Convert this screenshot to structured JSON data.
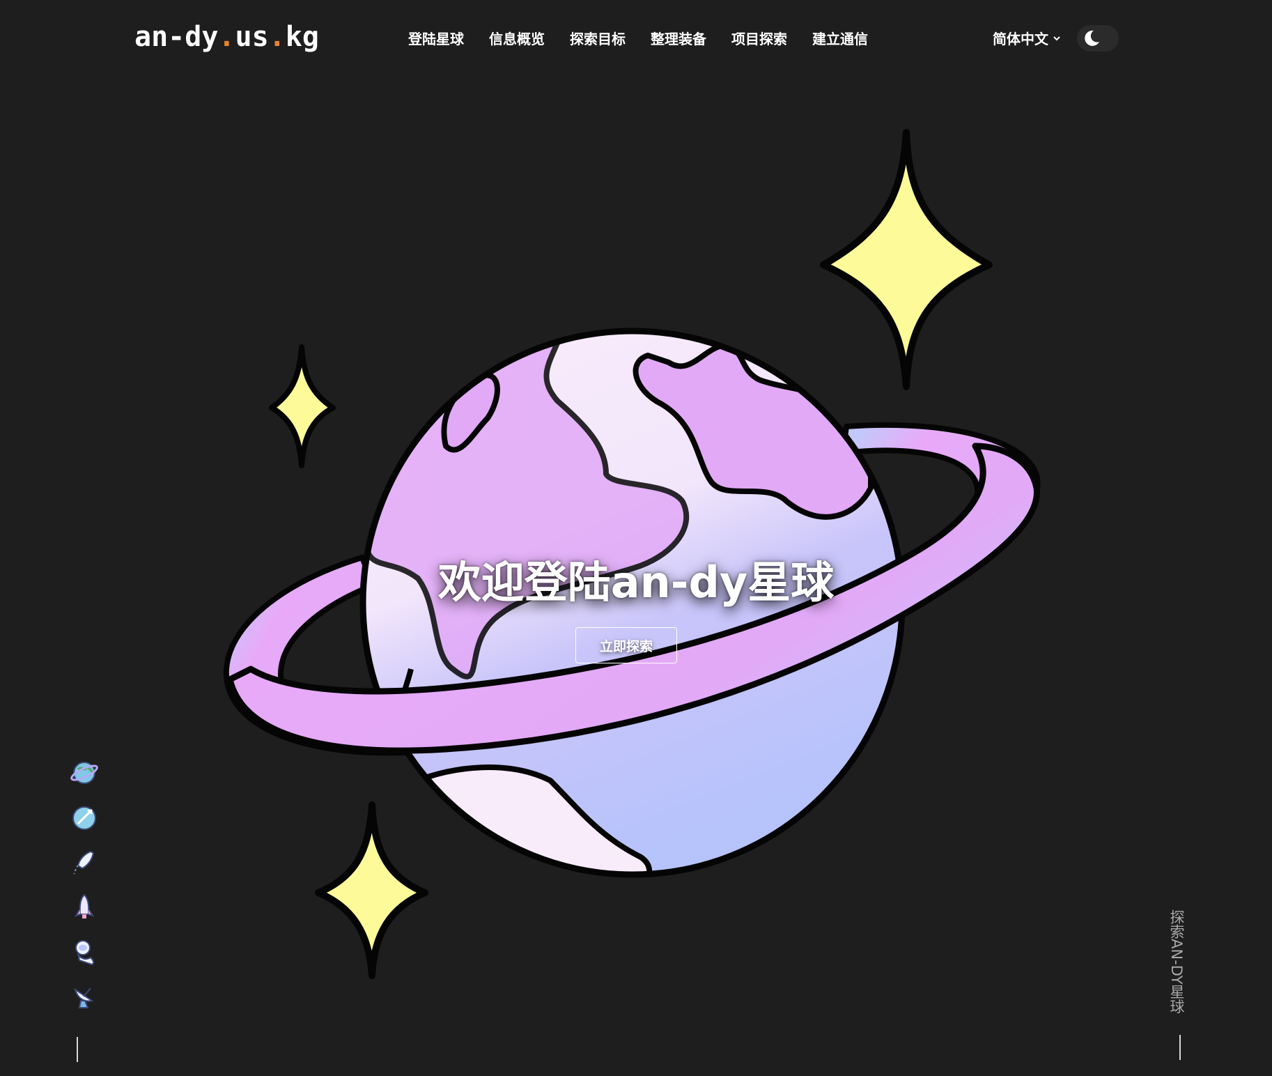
{
  "header": {
    "logo": {
      "part1": "an-dy",
      "dot1": ".",
      "part2": "us",
      "dot2": ".",
      "part3": "kg"
    },
    "nav": [
      "登陆星球",
      "信息概览",
      "探索目标",
      "整理装备",
      "项目探索",
      "建立通信"
    ],
    "language": "简体中文",
    "theme_toggle_icon": "moon-icon"
  },
  "hero": {
    "title": "欢迎登陆an-dy星球",
    "cta_label": "立即探索",
    "illustration": "ringed-planet",
    "colors": {
      "background": "#1e1e1e",
      "star": "#fdfa99",
      "planet_light": "#f8ecfb",
      "planet_purple": "#e2a9f7",
      "planet_blue": "#b9c5fb",
      "ring_blue": "#c0c8fb",
      "ring_pink": "#e8aaf8",
      "outline": "#050505",
      "logo_accent": "#e8842f"
    }
  },
  "sidebar": {
    "icons": [
      "planet-icon",
      "rocket-orbit-icon",
      "shooting-rocket-icon",
      "rocket-icon",
      "astronaut-icon",
      "satellite-dish-icon"
    ]
  },
  "scroll_hint": "探索AN-DY星球"
}
